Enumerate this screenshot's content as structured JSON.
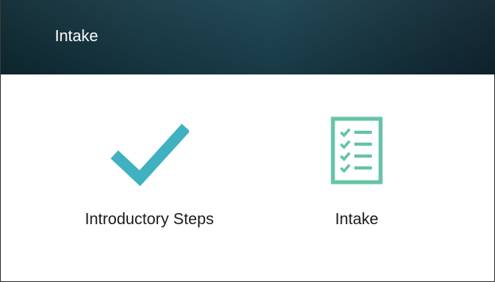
{
  "header": {
    "title": "Intake"
  },
  "tiles": [
    {
      "label": "Introductory Steps",
      "icon": "checkmark-icon"
    },
    {
      "label": "Intake",
      "icon": "checklist-icon"
    }
  ],
  "colors": {
    "header_bg": "#173a46",
    "header_text": "#ffffff",
    "accent_teal": "#3fb1c0",
    "accent_green": "#67c3a8",
    "label_text": "#1a1a1a"
  }
}
